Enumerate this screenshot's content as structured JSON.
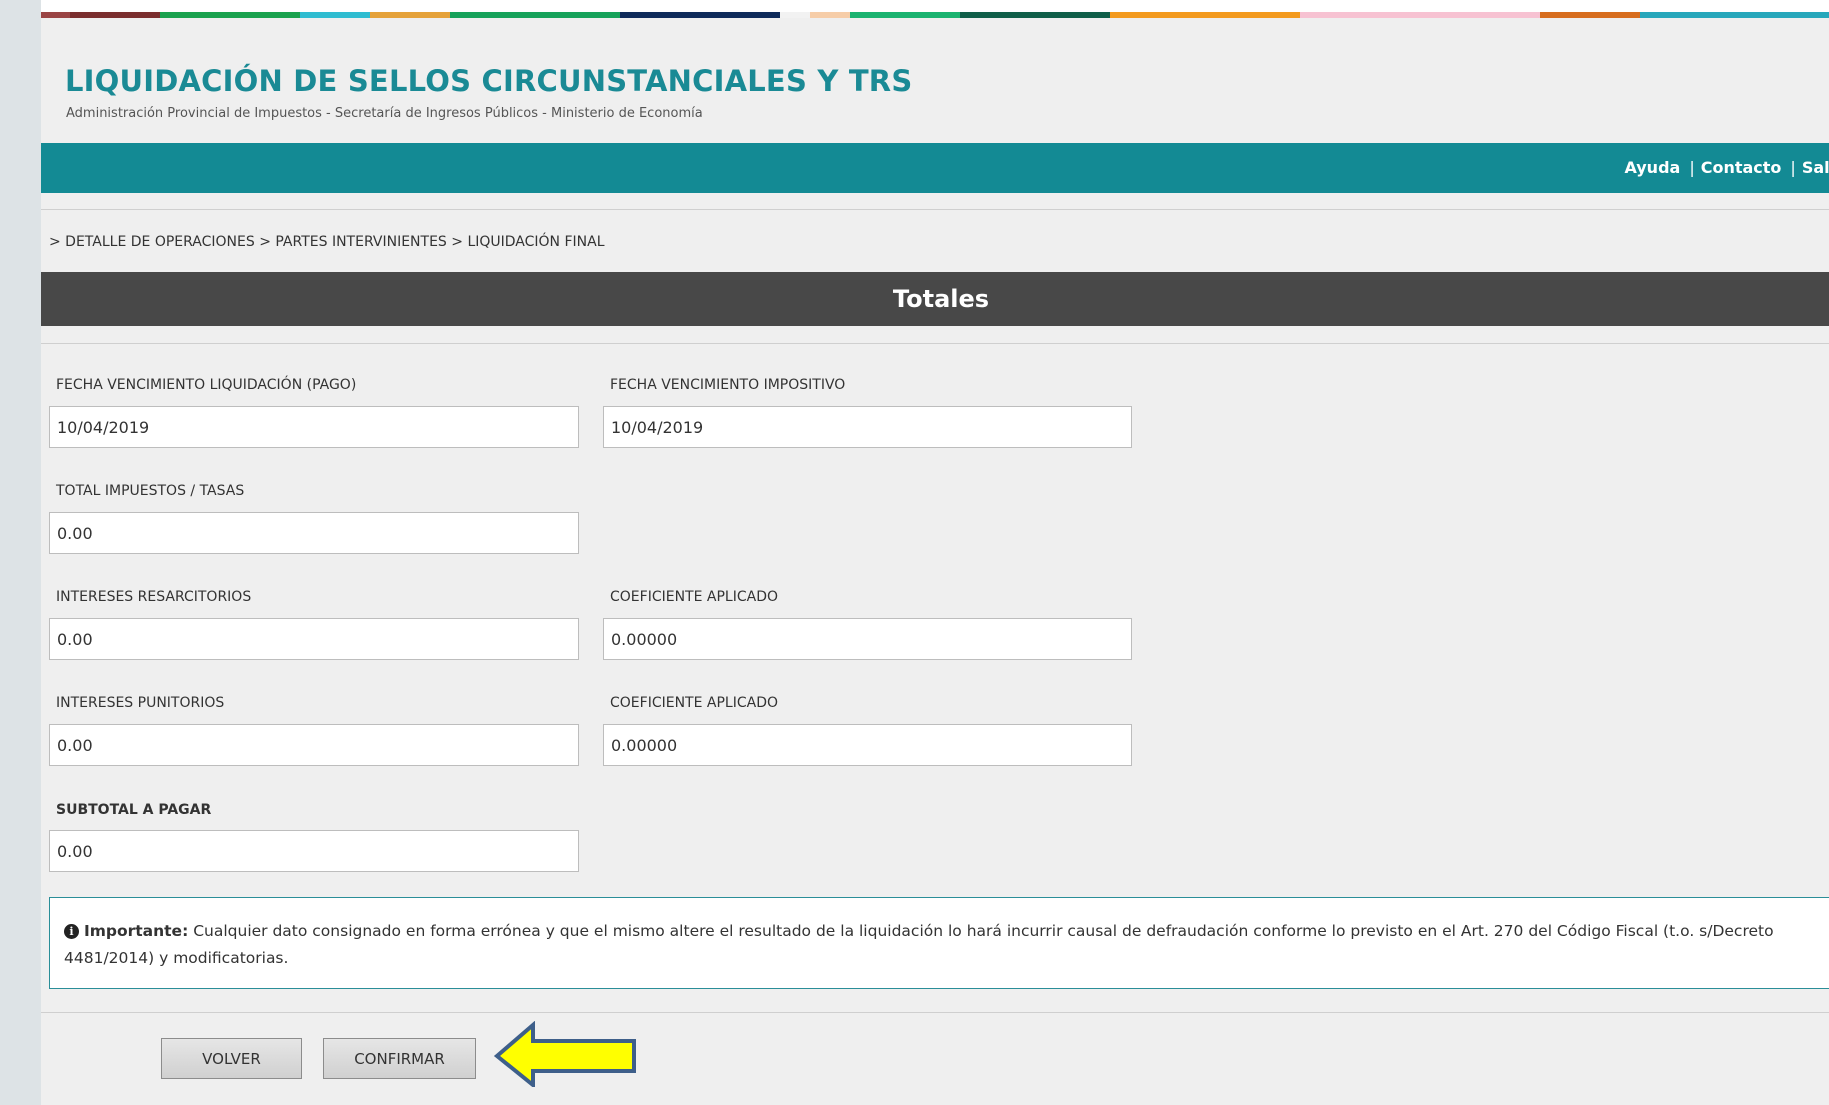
{
  "header": {
    "title": "LIQUIDACIÓN DE SELLOS CIRCUNSTANCIALES Y TRS",
    "subtitle": "Administración Provincial de Impuestos - Secretaría de Ingresos Públicos - Ministerio de Economía"
  },
  "nav": {
    "ayuda": "Ayuda",
    "contacto": "Contacto",
    "salir": "Salir",
    "separator": "|"
  },
  "breadcrumb": "> DETALLE DE OPERACIONES > PARTES INTERVINIENTES > LIQUIDACIÓN FINAL",
  "section": {
    "title": "Totales"
  },
  "fields": {
    "fecha_venc_liq": {
      "label": "FECHA VENCIMIENTO LIQUIDACIÓN (PAGO)",
      "value": "10/04/2019"
    },
    "fecha_venc_imp": {
      "label": "FECHA VENCIMIENTO IMPOSITIVO",
      "value": "10/04/2019"
    },
    "total_impuestos": {
      "label": "TOTAL IMPUESTOS / TASAS",
      "value": "0.00"
    },
    "intereses_resarcitorios": {
      "label": "INTERESES RESARCITORIOS",
      "value": "0.00"
    },
    "coef_resarcitorios": {
      "label": "COEFICIENTE APLICADO",
      "value": "0.00000"
    },
    "intereses_punitorios": {
      "label": "INTERESES PUNITORIOS",
      "value": "0.00"
    },
    "coef_punitorios": {
      "label": "COEFICIENTE APLICADO",
      "value": "0.00000"
    },
    "subtotal": {
      "label": "SUBTOTAL A PAGAR",
      "value": "0.00"
    }
  },
  "notice": {
    "icon": "info-circle-icon",
    "strong": "Importante:",
    "text": " Cualquier dato consignado en forma errónea y que el mismo altere el resultado de la liquidación lo hará incurrir causal de defraudación conforme lo previsto en el Art. 270 del Código Fiscal (t.o. s/Decreto 4481/2014) y modificatorias."
  },
  "buttons": {
    "volver": "VOLVER",
    "confirmar": "CONFIRMAR"
  },
  "annotation": {
    "icon": "yellow-arrow-left-icon",
    "fill": "#ffff00",
    "stroke": "#3e5f8a"
  },
  "colors": {
    "brand": "#1a8a95",
    "nav_bar": "#138a94",
    "section_bar": "#484848",
    "strip": [
      "#8a3b3b",
      "#1aa24e",
      "#29b6c8",
      "#e08a1e",
      "#0a8a5a",
      "#0e2a5a",
      "#f4c7a0",
      "#18b06a",
      "#f7c9d6",
      "#f39a1e",
      "#d8a3c0",
      "#e8e8e8",
      "#1aa4b8"
    ]
  }
}
